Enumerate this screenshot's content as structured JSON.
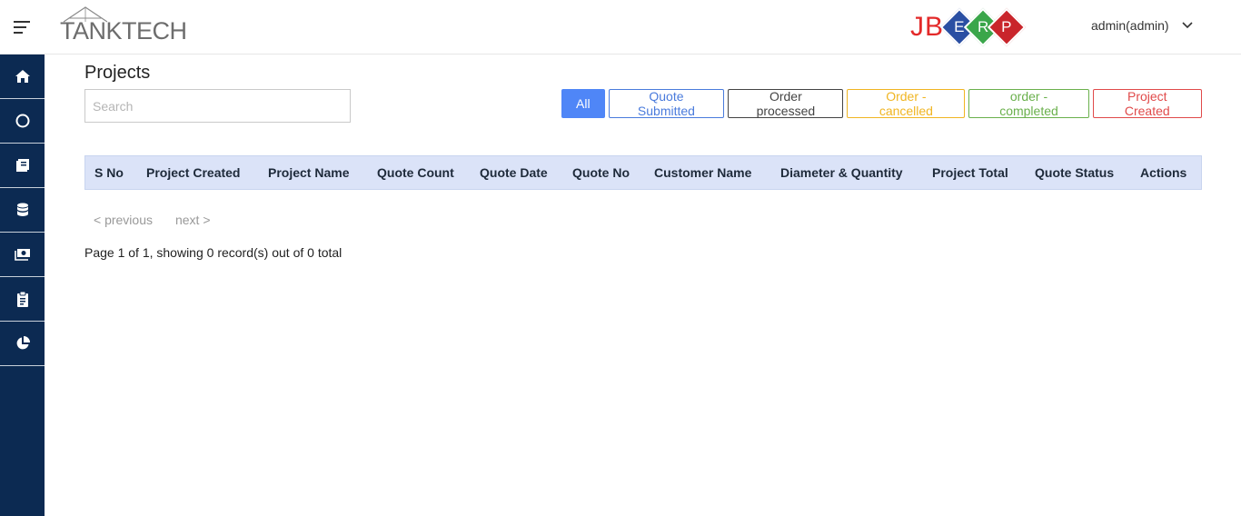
{
  "header": {
    "logo_text": "TANKTECH",
    "brand_jb": "JB",
    "brand_letters": [
      {
        "letter": "E",
        "color": "#2a4fa3"
      },
      {
        "letter": "R",
        "color": "#3aa64a"
      },
      {
        "letter": "P",
        "color": "#c9252b"
      }
    ],
    "user_label": "admin(admin)"
  },
  "sidebar": {
    "items": [
      {
        "icon": "home-icon"
      },
      {
        "icon": "circle-icon"
      },
      {
        "icon": "book-icon"
      },
      {
        "icon": "database-icon"
      },
      {
        "icon": "money-icon"
      },
      {
        "icon": "clipboard-icon"
      },
      {
        "icon": "pie-chart-icon"
      }
    ],
    "bg_color": "#0c2a52"
  },
  "main": {
    "title": "Projects",
    "search_placeholder": "Search",
    "search_value": "",
    "filters": {
      "all": "All",
      "quote_submitted": "Quote Submitted",
      "order_processed": "Order processed",
      "order_cancelled": "Order - cancelled",
      "order_completed": "order - completed",
      "project_created": "Project Created"
    },
    "columns": {
      "sno": "S No",
      "project_created": "Project Created",
      "project_name": "Project Name",
      "quote_count": "Quote Count",
      "quote_date": "Quote Date",
      "quote_no": "Quote No",
      "customer_name": "Customer Name",
      "diameter_quantity": "Diameter & Quantity",
      "project_total": "Project Total",
      "quote_status": "Quote Status",
      "actions": "Actions"
    },
    "pager": {
      "previous": "< previous",
      "next": "next >"
    },
    "summary": "Page 1 of 1, showing 0 record(s) out of 0 total"
  }
}
